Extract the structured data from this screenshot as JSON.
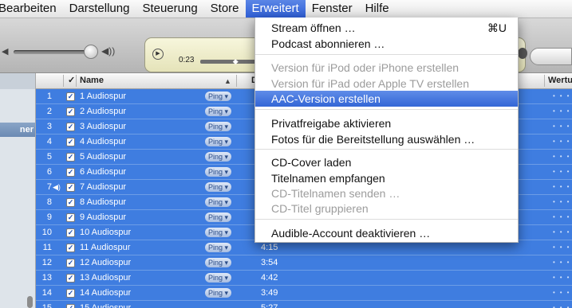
{
  "menubar": {
    "items": [
      "Bearbeiten",
      "Darstellung",
      "Steuerung",
      "Store",
      "Erweitert",
      "Fenster",
      "Hilfe"
    ],
    "active": "Erweitert"
  },
  "player": {
    "elapsed": "0:23",
    "progress": 0.56
  },
  "table": {
    "headers": {
      "check": "✓",
      "name": "Name",
      "time_partial": "D",
      "rating": "Wertu"
    },
    "rows": [
      {
        "num": "1",
        "name": "1 Audiospur",
        "ping": "Ping ▾",
        "time": ""
      },
      {
        "num": "2",
        "name": "2 Audiospur",
        "ping": "Ping ▾",
        "time": ""
      },
      {
        "num": "3",
        "name": "3 Audiospur",
        "ping": "Ping ▾",
        "time": ""
      },
      {
        "num": "4",
        "name": "4 Audiospur",
        "ping": "Ping ▾",
        "time": ""
      },
      {
        "num": "5",
        "name": "5 Audiospur",
        "ping": "Ping ▾",
        "time": ""
      },
      {
        "num": "6",
        "name": "6 Audiospur",
        "ping": "Ping ▾",
        "time": ""
      },
      {
        "num": "7",
        "name": "7 Audiospur",
        "ping": "Ping ▾",
        "time": "",
        "playing": true
      },
      {
        "num": "8",
        "name": "8 Audiospur",
        "ping": "Ping ▾",
        "time": ""
      },
      {
        "num": "9",
        "name": "9 Audiospur",
        "ping": "Ping ▾",
        "time": ""
      },
      {
        "num": "10",
        "name": "10 Audiospur",
        "ping": "Ping ▾",
        "time": ""
      },
      {
        "num": "11",
        "name": "11 Audiospur",
        "ping": "Ping ▾",
        "time": "4:15"
      },
      {
        "num": "12",
        "name": "12 Audiospur",
        "ping": "Ping ▾",
        "time": "3:54"
      },
      {
        "num": "13",
        "name": "13 Audiospur",
        "ping": "Ping ▾",
        "time": "4:42"
      },
      {
        "num": "14",
        "name": "14 Audiospur",
        "ping": "Ping ▾",
        "time": "3:49"
      },
      {
        "num": "15",
        "name": "15 Audiospur",
        "ping": "",
        "time": "5:27"
      }
    ]
  },
  "sidebar": {
    "selected_label": "ner"
  },
  "dropdown": {
    "items": [
      {
        "label": "Stream öffnen …",
        "shortcut": "⌘U",
        "state": "enabled"
      },
      {
        "label": "Podcast abonnieren …",
        "shortcut": "",
        "state": "enabled"
      },
      {
        "label": "Version für iPod oder iPhone erstellen",
        "shortcut": "",
        "state": "disabled"
      },
      {
        "label": "Version für iPad oder Apple TV erstellen",
        "shortcut": "",
        "state": "disabled"
      },
      {
        "label": "AAC-Version erstellen",
        "shortcut": "",
        "state": "highlighted"
      },
      {
        "label": "Privatfreigabe aktivieren",
        "shortcut": "",
        "state": "enabled"
      },
      {
        "label": "Fotos für die Bereitstellung auswählen …",
        "shortcut": "",
        "state": "enabled"
      },
      {
        "label": "CD-Cover laden",
        "shortcut": "",
        "state": "enabled"
      },
      {
        "label": "Titelnamen empfangen",
        "shortcut": "",
        "state": "enabled"
      },
      {
        "label": "CD-Titelnamen senden …",
        "shortcut": "",
        "state": "disabled"
      },
      {
        "label": "CD-Titel gruppieren",
        "shortcut": "",
        "state": "disabled"
      },
      {
        "label": "Audible-Account deaktivieren …",
        "shortcut": "",
        "state": "enabled"
      }
    ]
  },
  "colors": {
    "selection": "#3f7de0",
    "menu_highlight": "#3366d6"
  }
}
